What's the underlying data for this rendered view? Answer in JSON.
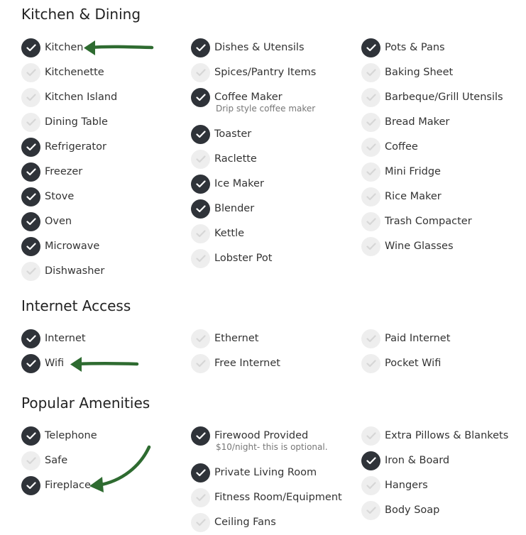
{
  "sections": [
    {
      "title": "Kitchen & Dining",
      "columns": [
        [
          {
            "label": "Kitchen",
            "checked": true
          },
          {
            "label": "Kitchenette",
            "checked": false
          },
          {
            "label": "Kitchen Island",
            "checked": false
          },
          {
            "label": "Dining Table",
            "checked": false
          },
          {
            "label": "Refrigerator",
            "checked": true
          },
          {
            "label": "Freezer",
            "checked": true
          },
          {
            "label": "Stove",
            "checked": true
          },
          {
            "label": "Oven",
            "checked": true
          },
          {
            "label": "Microwave",
            "checked": true
          },
          {
            "label": "Dishwasher",
            "checked": false
          }
        ],
        [
          {
            "label": "Dishes & Utensils",
            "checked": true
          },
          {
            "label": "Spices/Pantry Items",
            "checked": false
          },
          {
            "label": "Coffee Maker",
            "checked": true,
            "note": "Drip style coffee maker"
          },
          {
            "label": "Toaster",
            "checked": true
          },
          {
            "label": "Raclette",
            "checked": false
          },
          {
            "label": "Ice Maker",
            "checked": true
          },
          {
            "label": "Blender",
            "checked": true
          },
          {
            "label": "Kettle",
            "checked": false
          },
          {
            "label": "Lobster Pot",
            "checked": false
          }
        ],
        [
          {
            "label": "Pots & Pans",
            "checked": true
          },
          {
            "label": "Baking Sheet",
            "checked": false
          },
          {
            "label": "Barbeque/Grill Utensils",
            "checked": false
          },
          {
            "label": "Bread Maker",
            "checked": false
          },
          {
            "label": "Coffee",
            "checked": false
          },
          {
            "label": "Mini Fridge",
            "checked": false
          },
          {
            "label": "Rice Maker",
            "checked": false
          },
          {
            "label": "Trash Compacter",
            "checked": false
          },
          {
            "label": "Wine Glasses",
            "checked": false
          }
        ]
      ]
    },
    {
      "title": "Internet Access",
      "columns": [
        [
          {
            "label": "Internet",
            "checked": true
          },
          {
            "label": "Wifi",
            "checked": true
          }
        ],
        [
          {
            "label": "Ethernet",
            "checked": false
          },
          {
            "label": "Free Internet",
            "checked": false
          }
        ],
        [
          {
            "label": "Paid Internet",
            "checked": false
          },
          {
            "label": "Pocket Wifi",
            "checked": false
          }
        ]
      ]
    },
    {
      "title": "Popular Amenities",
      "columns": [
        [
          {
            "label": "Telephone",
            "checked": true
          },
          {
            "label": "Safe",
            "checked": false
          },
          {
            "label": "Fireplace",
            "checked": true
          }
        ],
        [
          {
            "label": "Firewood Provided",
            "checked": true,
            "note": "$10/night- this is optional."
          },
          {
            "label": "Private Living Room",
            "checked": true
          },
          {
            "label": "Fitness Room/Equipment",
            "checked": false
          },
          {
            "label": "Ceiling Fans",
            "checked": false
          }
        ],
        [
          {
            "label": "Extra Pillows & Blankets",
            "checked": false
          },
          {
            "label": "Iron & Board",
            "checked": true
          },
          {
            "label": "Hangers",
            "checked": false
          },
          {
            "label": "Body Soap",
            "checked": false
          }
        ]
      ]
    }
  ],
  "colors": {
    "checked_circle": "#2f3339",
    "unchecked_circle": "#eeeeee",
    "checked_mark": "#ffffff",
    "unchecked_mark": "#d6d6d6",
    "arrow": "#2e6b30"
  },
  "annotations": [
    "green-arrow-kitchen",
    "green-arrow-wifi",
    "green-arrow-fireplace"
  ]
}
